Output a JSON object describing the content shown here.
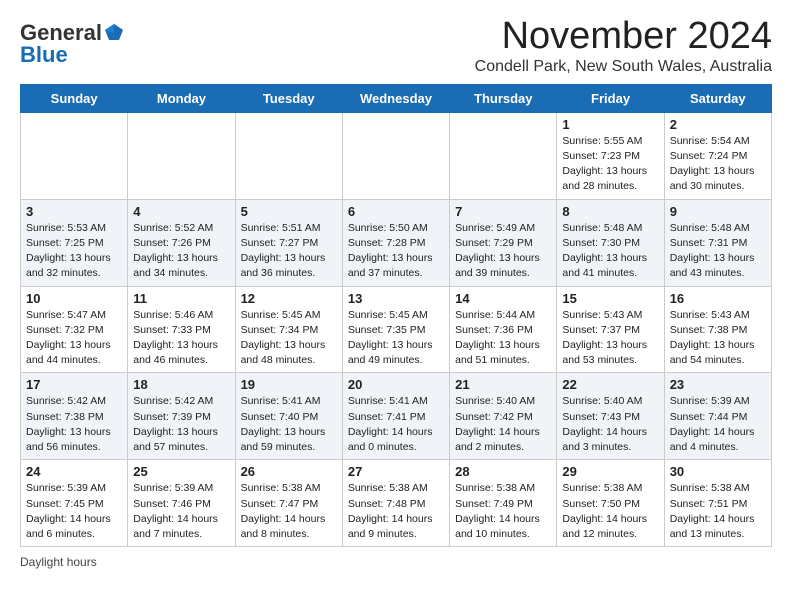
{
  "header": {
    "logo_general": "General",
    "logo_blue": "Blue",
    "month": "November 2024",
    "location": "Condell Park, New South Wales, Australia"
  },
  "days_of_week": [
    "Sunday",
    "Monday",
    "Tuesday",
    "Wednesday",
    "Thursday",
    "Friday",
    "Saturday"
  ],
  "weeks": [
    [
      {
        "day": "",
        "info": ""
      },
      {
        "day": "",
        "info": ""
      },
      {
        "day": "",
        "info": ""
      },
      {
        "day": "",
        "info": ""
      },
      {
        "day": "",
        "info": ""
      },
      {
        "day": "1",
        "info": "Sunrise: 5:55 AM\nSunset: 7:23 PM\nDaylight: 13 hours and 28 minutes."
      },
      {
        "day": "2",
        "info": "Sunrise: 5:54 AM\nSunset: 7:24 PM\nDaylight: 13 hours and 30 minutes."
      }
    ],
    [
      {
        "day": "3",
        "info": "Sunrise: 5:53 AM\nSunset: 7:25 PM\nDaylight: 13 hours and 32 minutes."
      },
      {
        "day": "4",
        "info": "Sunrise: 5:52 AM\nSunset: 7:26 PM\nDaylight: 13 hours and 34 minutes."
      },
      {
        "day": "5",
        "info": "Sunrise: 5:51 AM\nSunset: 7:27 PM\nDaylight: 13 hours and 36 minutes."
      },
      {
        "day": "6",
        "info": "Sunrise: 5:50 AM\nSunset: 7:28 PM\nDaylight: 13 hours and 37 minutes."
      },
      {
        "day": "7",
        "info": "Sunrise: 5:49 AM\nSunset: 7:29 PM\nDaylight: 13 hours and 39 minutes."
      },
      {
        "day": "8",
        "info": "Sunrise: 5:48 AM\nSunset: 7:30 PM\nDaylight: 13 hours and 41 minutes."
      },
      {
        "day": "9",
        "info": "Sunrise: 5:48 AM\nSunset: 7:31 PM\nDaylight: 13 hours and 43 minutes."
      }
    ],
    [
      {
        "day": "10",
        "info": "Sunrise: 5:47 AM\nSunset: 7:32 PM\nDaylight: 13 hours and 44 minutes."
      },
      {
        "day": "11",
        "info": "Sunrise: 5:46 AM\nSunset: 7:33 PM\nDaylight: 13 hours and 46 minutes."
      },
      {
        "day": "12",
        "info": "Sunrise: 5:45 AM\nSunset: 7:34 PM\nDaylight: 13 hours and 48 minutes."
      },
      {
        "day": "13",
        "info": "Sunrise: 5:45 AM\nSunset: 7:35 PM\nDaylight: 13 hours and 49 minutes."
      },
      {
        "day": "14",
        "info": "Sunrise: 5:44 AM\nSunset: 7:36 PM\nDaylight: 13 hours and 51 minutes."
      },
      {
        "day": "15",
        "info": "Sunrise: 5:43 AM\nSunset: 7:37 PM\nDaylight: 13 hours and 53 minutes."
      },
      {
        "day": "16",
        "info": "Sunrise: 5:43 AM\nSunset: 7:38 PM\nDaylight: 13 hours and 54 minutes."
      }
    ],
    [
      {
        "day": "17",
        "info": "Sunrise: 5:42 AM\nSunset: 7:38 PM\nDaylight: 13 hours and 56 minutes."
      },
      {
        "day": "18",
        "info": "Sunrise: 5:42 AM\nSunset: 7:39 PM\nDaylight: 13 hours and 57 minutes."
      },
      {
        "day": "19",
        "info": "Sunrise: 5:41 AM\nSunset: 7:40 PM\nDaylight: 13 hours and 59 minutes."
      },
      {
        "day": "20",
        "info": "Sunrise: 5:41 AM\nSunset: 7:41 PM\nDaylight: 14 hours and 0 minutes."
      },
      {
        "day": "21",
        "info": "Sunrise: 5:40 AM\nSunset: 7:42 PM\nDaylight: 14 hours and 2 minutes."
      },
      {
        "day": "22",
        "info": "Sunrise: 5:40 AM\nSunset: 7:43 PM\nDaylight: 14 hours and 3 minutes."
      },
      {
        "day": "23",
        "info": "Sunrise: 5:39 AM\nSunset: 7:44 PM\nDaylight: 14 hours and 4 minutes."
      }
    ],
    [
      {
        "day": "24",
        "info": "Sunrise: 5:39 AM\nSunset: 7:45 PM\nDaylight: 14 hours and 6 minutes."
      },
      {
        "day": "25",
        "info": "Sunrise: 5:39 AM\nSunset: 7:46 PM\nDaylight: 14 hours and 7 minutes."
      },
      {
        "day": "26",
        "info": "Sunrise: 5:38 AM\nSunset: 7:47 PM\nDaylight: 14 hours and 8 minutes."
      },
      {
        "day": "27",
        "info": "Sunrise: 5:38 AM\nSunset: 7:48 PM\nDaylight: 14 hours and 9 minutes."
      },
      {
        "day": "28",
        "info": "Sunrise: 5:38 AM\nSunset: 7:49 PM\nDaylight: 14 hours and 10 minutes."
      },
      {
        "day": "29",
        "info": "Sunrise: 5:38 AM\nSunset: 7:50 PM\nDaylight: 14 hours and 12 minutes."
      },
      {
        "day": "30",
        "info": "Sunrise: 5:38 AM\nSunset: 7:51 PM\nDaylight: 14 hours and 13 minutes."
      }
    ]
  ],
  "footer": {
    "daylight_label": "Daylight hours"
  }
}
